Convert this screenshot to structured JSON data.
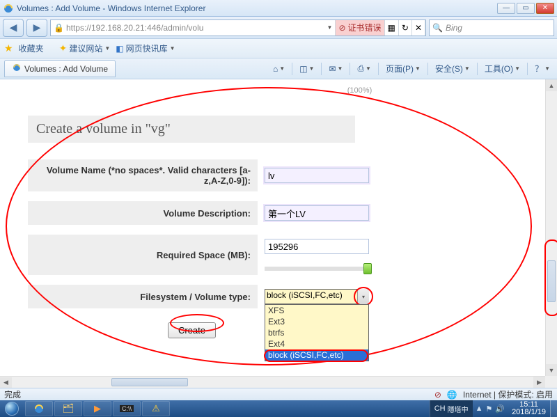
{
  "window": {
    "title": "Volumes : Add Volume - Windows Internet Explorer",
    "min": "—",
    "restore": "▭",
    "close": "✕"
  },
  "nav": {
    "back": "◀",
    "fwd": "▶",
    "url": "https://192.168.20.21:446/admin/volu",
    "cert_error": "证书错误",
    "refresh": "↻",
    "stop": "✕",
    "search_placeholder": "Bing",
    "search_icon": "🔍"
  },
  "favbar": {
    "favorites": "收藏夹",
    "suggested": "建议网站",
    "webslice": "网页快讯库"
  },
  "tab": {
    "title": "Volumes : Add Volume"
  },
  "cmd": {
    "home": "⌂",
    "feeds": "◫",
    "mail": "✉",
    "print": "⎙",
    "page": "页面(P)",
    "safety": "安全(S)",
    "tools": "工具(O)",
    "help": "？"
  },
  "page": {
    "free_pct": "(100%)",
    "heading": "Create a volume in \"vg\"",
    "labels": {
      "name": "Volume Name (*no spaces*. Valid characters [a-z,A-Z,0-9]):",
      "desc": "Volume Description:",
      "space": "Required Space (MB):",
      "fstype": "Filesystem / Volume type:"
    },
    "values": {
      "name": "lv",
      "desc": "第一个LV",
      "space": "195296",
      "fstype_selected": "block (iSCSI,FC,etc)"
    },
    "fs_options": [
      "XFS",
      "Ext3",
      "btrfs",
      "Ext4",
      "block (iSCSI,FC,etc)"
    ],
    "create_btn": "Create"
  },
  "status": {
    "done": "完成",
    "zone": "Internet | 保护模式: 启用"
  },
  "taskbar": {
    "ime": "CH",
    "ime_status": "隱塔中",
    "time": "15:11",
    "date": "2018/1/19"
  }
}
